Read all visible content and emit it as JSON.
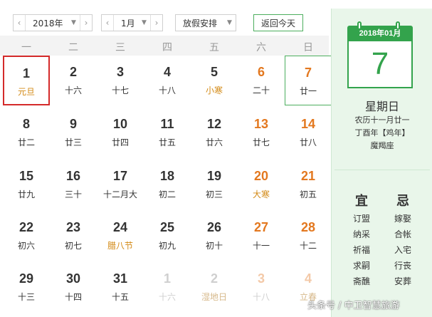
{
  "toolbar": {
    "year": "2018年",
    "month": "1月",
    "holiday": "放假安排",
    "today_label": "返回今天"
  },
  "weekdays": [
    "一",
    "二",
    "三",
    "四",
    "五",
    "六",
    "日"
  ],
  "days": [
    {
      "num": "1",
      "sub": "元旦",
      "festival": true,
      "selected": true
    },
    {
      "num": "2",
      "sub": "十六"
    },
    {
      "num": "3",
      "sub": "十七"
    },
    {
      "num": "4",
      "sub": "十八"
    },
    {
      "num": "5",
      "sub": "小寒",
      "festival": true
    },
    {
      "num": "6",
      "sub": "二十",
      "weekend": true
    },
    {
      "num": "7",
      "sub": "廿一",
      "weekend": true,
      "today": true
    },
    {
      "num": "8",
      "sub": "廿二"
    },
    {
      "num": "9",
      "sub": "廿三"
    },
    {
      "num": "10",
      "sub": "廿四"
    },
    {
      "num": "11",
      "sub": "廿五"
    },
    {
      "num": "12",
      "sub": "廿六"
    },
    {
      "num": "13",
      "sub": "廿七",
      "weekend": true
    },
    {
      "num": "14",
      "sub": "廿八",
      "weekend": true
    },
    {
      "num": "15",
      "sub": "廿九"
    },
    {
      "num": "16",
      "sub": "三十"
    },
    {
      "num": "17",
      "sub": "十二月大"
    },
    {
      "num": "18",
      "sub": "初二"
    },
    {
      "num": "19",
      "sub": "初三"
    },
    {
      "num": "20",
      "sub": "大寒",
      "festival": true,
      "weekend": true
    },
    {
      "num": "21",
      "sub": "初五",
      "weekend": true
    },
    {
      "num": "22",
      "sub": "初六"
    },
    {
      "num": "23",
      "sub": "初七"
    },
    {
      "num": "24",
      "sub": "腊八节",
      "festival": true
    },
    {
      "num": "25",
      "sub": "初九"
    },
    {
      "num": "26",
      "sub": "初十"
    },
    {
      "num": "27",
      "sub": "十一",
      "weekend": true
    },
    {
      "num": "28",
      "sub": "十二",
      "weekend": true
    },
    {
      "num": "29",
      "sub": "十三"
    },
    {
      "num": "30",
      "sub": "十四"
    },
    {
      "num": "31",
      "sub": "十五"
    },
    {
      "num": "1",
      "sub": "十六",
      "other": true
    },
    {
      "num": "2",
      "sub": "湿地日",
      "festival": true,
      "other": true
    },
    {
      "num": "3",
      "sub": "十八",
      "other": true,
      "weekend": true
    },
    {
      "num": "4",
      "sub": "立春",
      "festival": true,
      "other": true,
      "weekend": true
    }
  ],
  "side": {
    "header_date": "2018年01月",
    "day": "7",
    "weekday": "星期日",
    "lunar": "农历十一月廿一",
    "ganzhi": "丁酉年【鸡年】",
    "constellation": "魔羯座",
    "yi_title": "宜",
    "ji_title": "忌",
    "yi": [
      "订盟",
      "纳采",
      "祈福",
      "求嗣",
      "斋醮"
    ],
    "ji": [
      "嫁娶",
      "合帐",
      "入宅",
      "行丧",
      "安葬"
    ]
  },
  "watermark": "头条号 / 中卫智慧旅游",
  "colors": {
    "accent_green": "#33a34c",
    "weekend_orange": "#e3781f",
    "festival_gold": "#d38a16",
    "selected_red": "#d42a2a"
  }
}
